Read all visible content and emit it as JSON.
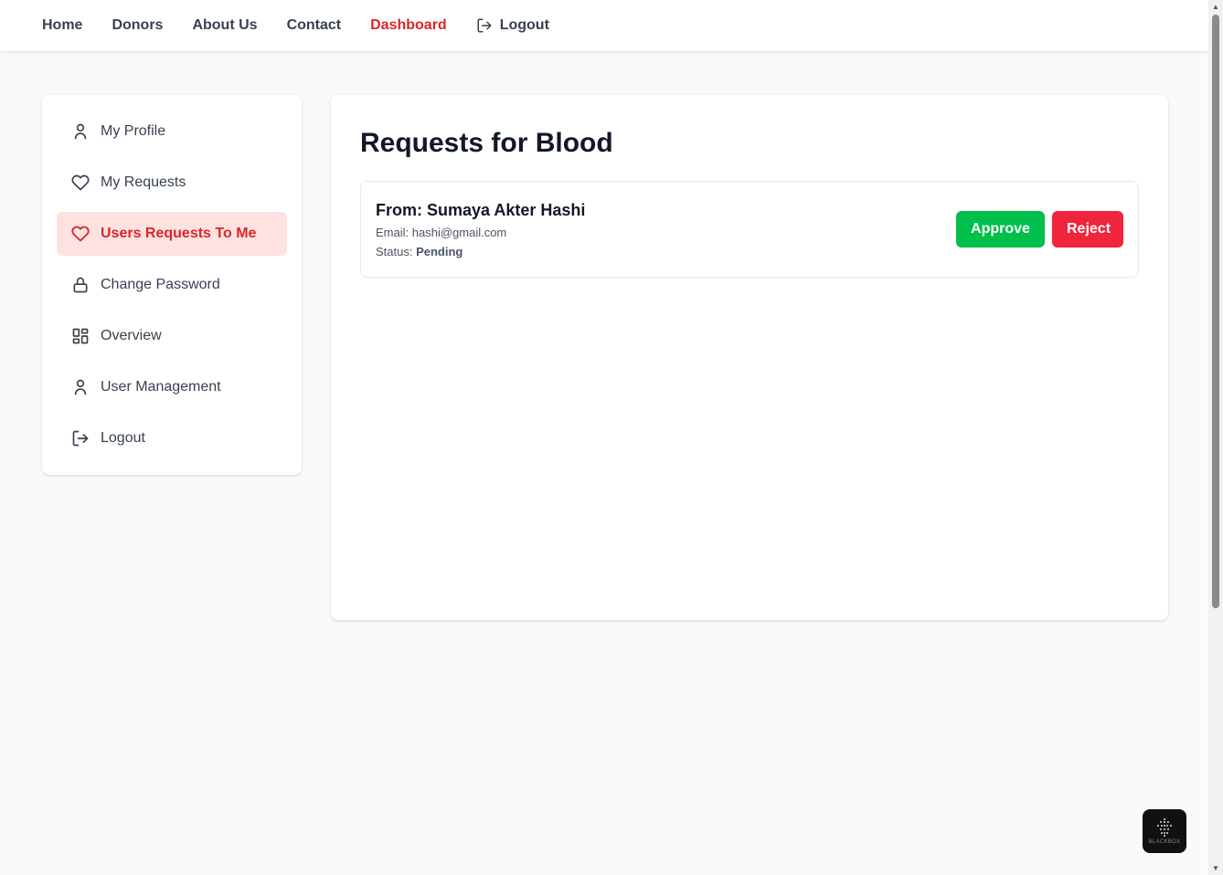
{
  "nav": {
    "home": "Home",
    "donors": "Donors",
    "about": "About Us",
    "contact": "Contact",
    "dashboard": "Dashboard",
    "logout": "Logout"
  },
  "sidebar": {
    "items": [
      {
        "label": "My Profile",
        "icon": "user-icon"
      },
      {
        "label": "My Requests",
        "icon": "heart-icon"
      },
      {
        "label": "Users Requests To Me",
        "icon": "heart-icon",
        "active": true
      },
      {
        "label": "Change Password",
        "icon": "lock-icon"
      },
      {
        "label": "Overview",
        "icon": "grid-icon"
      },
      {
        "label": "User Management",
        "icon": "user-icon"
      },
      {
        "label": "Logout",
        "icon": "logout-icon"
      }
    ]
  },
  "main": {
    "title": "Requests for Blood",
    "requests": [
      {
        "from": "From: Sumaya Akter Hashi",
        "email_label": "Email:",
        "email": "hashi@gmail.com",
        "status_label": "Status:",
        "status": "Pending",
        "approve_label": "Approve",
        "reject_label": "Reject"
      }
    ]
  },
  "widget": {
    "label": "BLACKBOX"
  },
  "colors": {
    "accent": "#dc2626",
    "active_bg": "#fee2e2",
    "approve": "#00c04b",
    "reject": "#f0243a"
  }
}
